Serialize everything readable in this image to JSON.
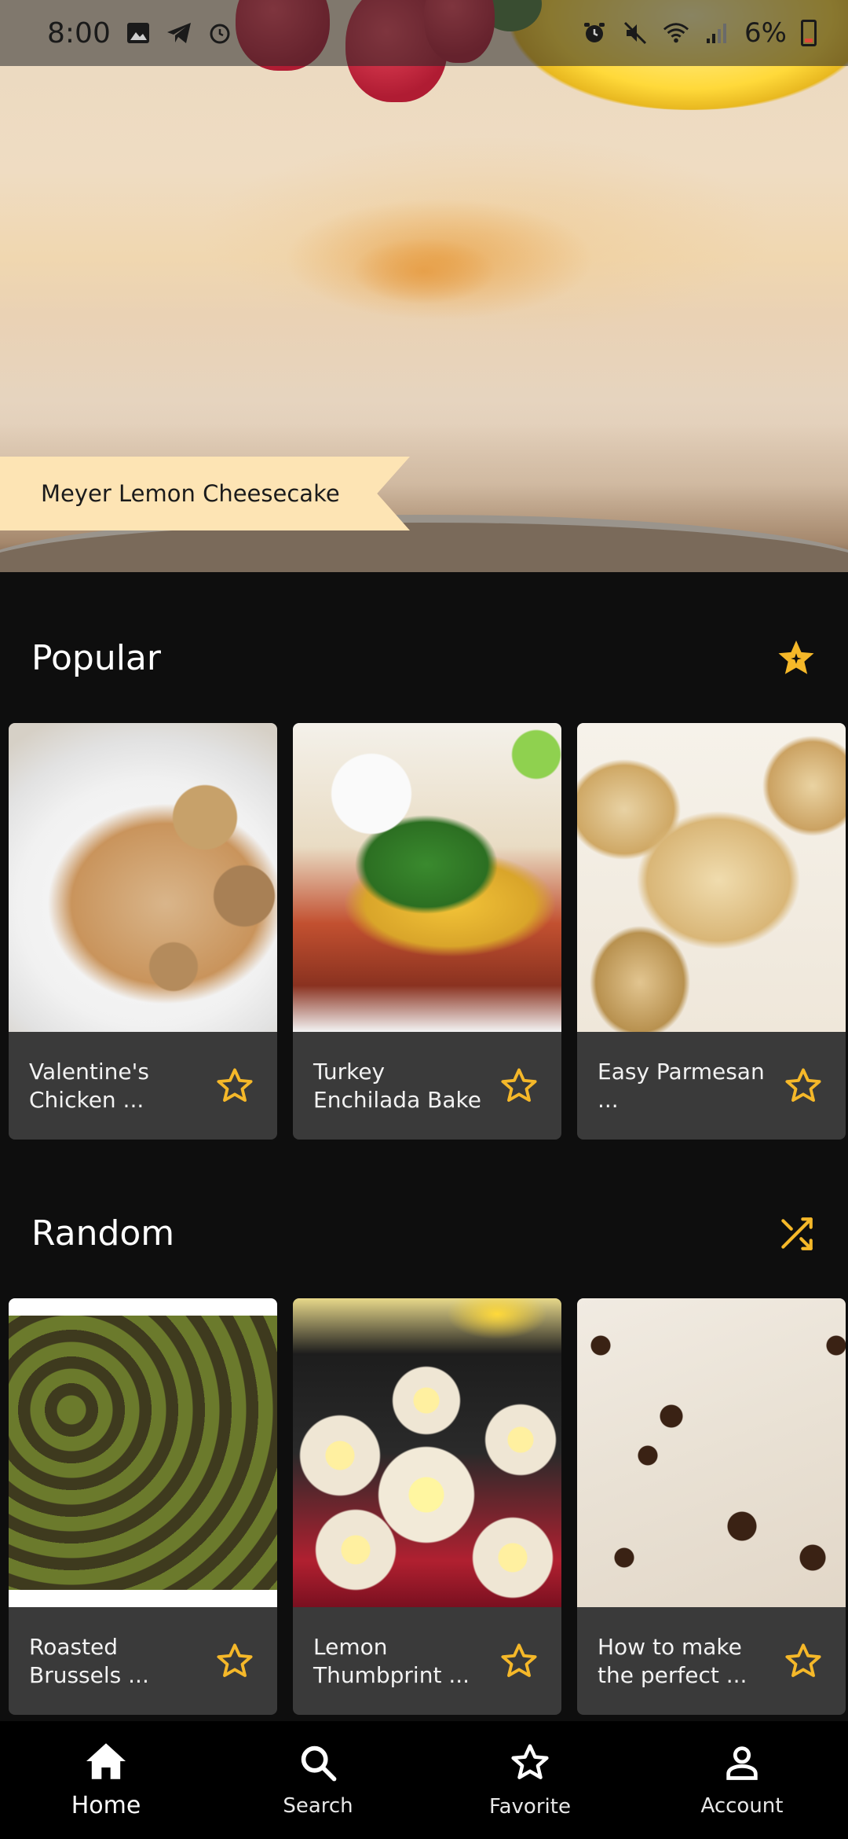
{
  "status_bar": {
    "time": "8:00",
    "battery": "6%"
  },
  "hero": {
    "featured_title": "Meyer Lemon Cheesecake"
  },
  "popular": {
    "title": "Popular",
    "icon": "star-sparkle-icon",
    "cards": [
      {
        "title": "Valentine's Chicken ...",
        "image": "chicken-mushroom-dish"
      },
      {
        "title": "Turkey Enchilada Bake",
        "image": "enchilada-bake-dish"
      },
      {
        "title": "Easy Parmesan ...",
        "image": "garlic-knots-dish"
      }
    ]
  },
  "random": {
    "title": "Random",
    "icon": "shuffle-icon",
    "cards": [
      {
        "title": "Roasted Brussels ...",
        "image": "brussels-sprouts-dish"
      },
      {
        "title": "Lemon Thumbprint ...",
        "image": "thumbprint-cookies-dish"
      },
      {
        "title": "How to make the perfect ...",
        "image": "cheesecake-bars-dish"
      }
    ]
  },
  "nav": {
    "items": [
      {
        "label": "Home",
        "icon": "home-icon",
        "active": true
      },
      {
        "label": "Search",
        "icon": "search-icon",
        "active": false
      },
      {
        "label": "Favorite",
        "icon": "star-icon",
        "active": false
      },
      {
        "label": "Account",
        "icon": "account-icon",
        "active": false
      }
    ]
  },
  "colors": {
    "accent_star": "#f5b829",
    "ribbon": "#fde4b4",
    "background": "#0e0e0e",
    "card": "#3a3a3a"
  }
}
